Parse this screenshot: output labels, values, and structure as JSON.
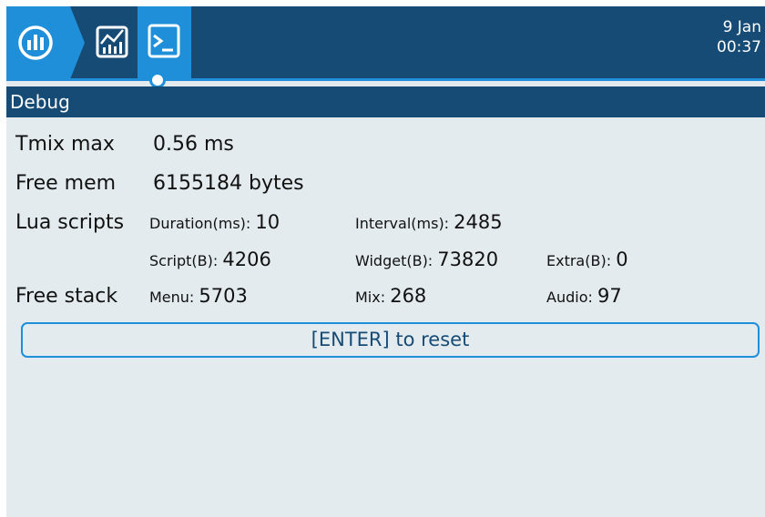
{
  "colors": {
    "topbar": "#164b76",
    "accent": "#1e8fd8",
    "background": "#e3ebee"
  },
  "header": {
    "tabs": [
      {
        "icon": "gauge-bars-icon"
      },
      {
        "icon": "chart-icon"
      },
      {
        "icon": "terminal-icon",
        "active": true
      }
    ],
    "clock": {
      "date": "9 Jan",
      "time": "00:37"
    }
  },
  "page": {
    "title": "Debug"
  },
  "debug": {
    "tmix": {
      "label": "Tmix max",
      "value": "0.56 ms"
    },
    "free_mem": {
      "label": "Free mem",
      "value": "6155184 bytes"
    },
    "lua": {
      "label": "Lua scripts",
      "duration": {
        "key": "Duration(ms):",
        "value": "10"
      },
      "interval": {
        "key": "Interval(ms):",
        "value": "2485"
      },
      "script": {
        "key": "Script(B):",
        "value": "4206"
      },
      "widget": {
        "key": "Widget(B):",
        "value": "73820"
      },
      "extra": {
        "key": "Extra(B):",
        "value": "0"
      }
    },
    "stack": {
      "label": "Free stack",
      "menu": {
        "key": "Menu:",
        "value": "5703"
      },
      "mix": {
        "key": "Mix:",
        "value": "268"
      },
      "audio": {
        "key": "Audio:",
        "value": "97"
      }
    }
  },
  "reset_button": {
    "label": "[ENTER] to reset"
  }
}
